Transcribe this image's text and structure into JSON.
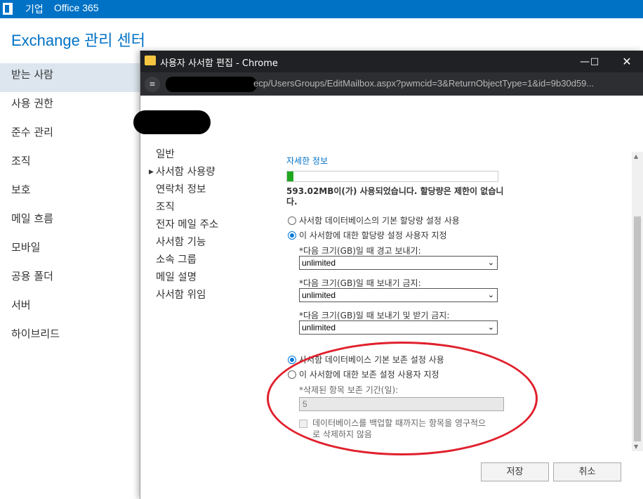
{
  "topbar": {
    "company": "기업",
    "product": "Office 365"
  },
  "eac": {
    "title": "Exchange 관리 센터"
  },
  "leftnav": {
    "items": [
      {
        "label": "받는 사람"
      },
      {
        "label": "사용 권한"
      },
      {
        "label": "준수 관리"
      },
      {
        "label": "조직"
      },
      {
        "label": "보호"
      },
      {
        "label": "메일 흐름"
      },
      {
        "label": "모바일"
      },
      {
        "label": "공용 폴더"
      },
      {
        "label": "서버"
      },
      {
        "label": "하이브리드"
      }
    ],
    "active_index": 0
  },
  "popup": {
    "window_title": "사용자 사서함 편집 - Chrome",
    "url": "ecp/UsersGroups/EditMailbox.aspx?pwmcid=3&ReturnObjectType=1&id=9b30d59...",
    "tabs": [
      {
        "label": "일반"
      },
      {
        "label": "사서함 사용량"
      },
      {
        "label": "연락처 정보"
      },
      {
        "label": "조직"
      },
      {
        "label": "전자 메일 주소"
      },
      {
        "label": "사서함 기능"
      },
      {
        "label": "소속 그룹"
      },
      {
        "label": "메일 설명"
      },
      {
        "label": "사서함 위임"
      }
    ],
    "active_tab_index": 1,
    "content": {
      "details_link": "자세한 정보",
      "usage_fraction": 0.03,
      "usage_text": "593.02MB이(가) 사용되었습니다. 할당량은 제한이 없습니다.",
      "quota": {
        "option_default": "사서함 데이터베이스의 기본 할당량 설정 사용",
        "option_custom": "이 사서함에 대한 할당량 설정 사용자 지정",
        "selected": "custom",
        "warn_label": "*다음 크기(GB)일 때 경고 보내기:",
        "warn_value": "unlimited",
        "send_label": "*다음 크기(GB)일 때 보내기 금지:",
        "send_value": "unlimited",
        "sendrecv_label": "*다음 크기(GB)일 때 보내기 및 받기 금지:",
        "sendrecv_value": "unlimited"
      },
      "retention": {
        "option_default": "사서함 데이터베이스 기본 보존 설정 사용",
        "option_custom": "이 사서함에 대한 보존 설정 사용자 지정",
        "selected": "default",
        "days_label": "*삭제된 항목 보존 기간(일):",
        "days_value": "5",
        "checkbox_label": "데이터베이스를 백업할 때까지는 항목을 영구적으로 삭제하지 않음"
      }
    },
    "buttons": {
      "save": "저장",
      "cancel": "취소"
    }
  },
  "colors": {
    "accent": "#0072c6",
    "annotation": "#e0202c",
    "usage_fill": "#1fa81f"
  }
}
